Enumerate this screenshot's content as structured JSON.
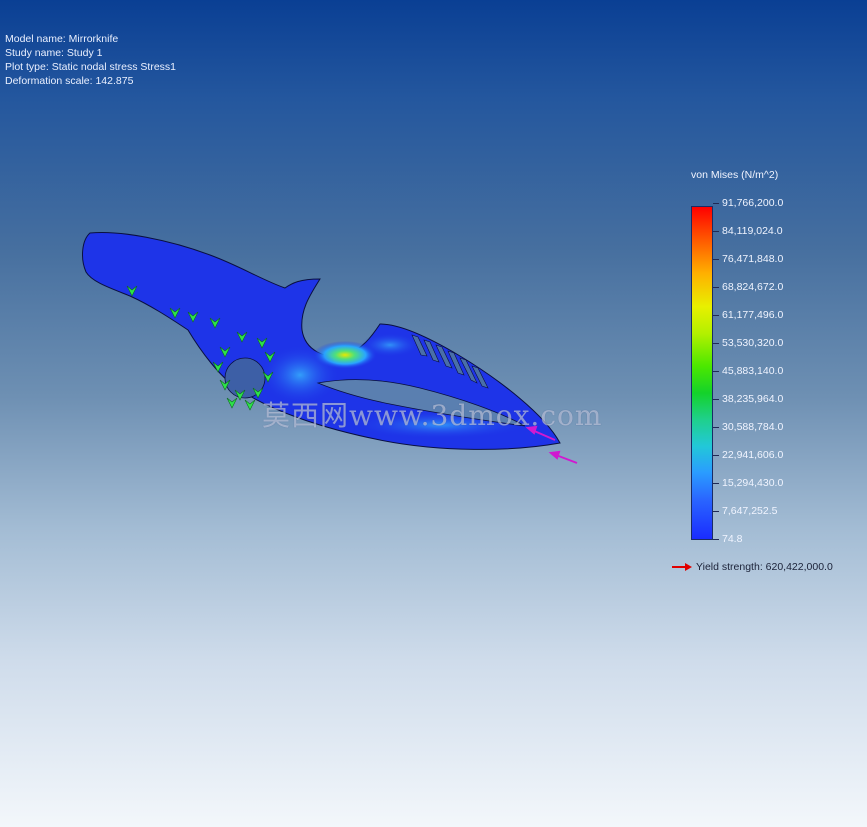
{
  "info": {
    "model_name": "Model name: Mirrorknife",
    "study_name": "Study name: Study 1",
    "plot_type": "Plot type: Static nodal stress Stress1",
    "deformation_scale": "Deformation scale: 142.875"
  },
  "legend": {
    "title": "von Mises (N/m^2)",
    "values": [
      "91,766,200.0",
      "84,119,024.0",
      "76,471,848.0",
      "68,824,672.0",
      "61,177,496.0",
      "53,530,320.0",
      "45,883,140.0",
      "38,235,964.0",
      "30,588,784.0",
      "22,941,606.0",
      "15,294,430.0",
      "7,647,252.5",
      "74.8"
    ],
    "max_color": "#ff0000",
    "min_color": "#1a2cff"
  },
  "yield": {
    "label": "Yield strength: 620,422,000.0",
    "arrow_color": "#e00000",
    "icon": "red-arrow-icon"
  },
  "watermark": "莫西网www.3dmox.com",
  "colors": {
    "part": "#1e34e8",
    "fixture": "#2ee34a",
    "load": "#d01ad0"
  }
}
